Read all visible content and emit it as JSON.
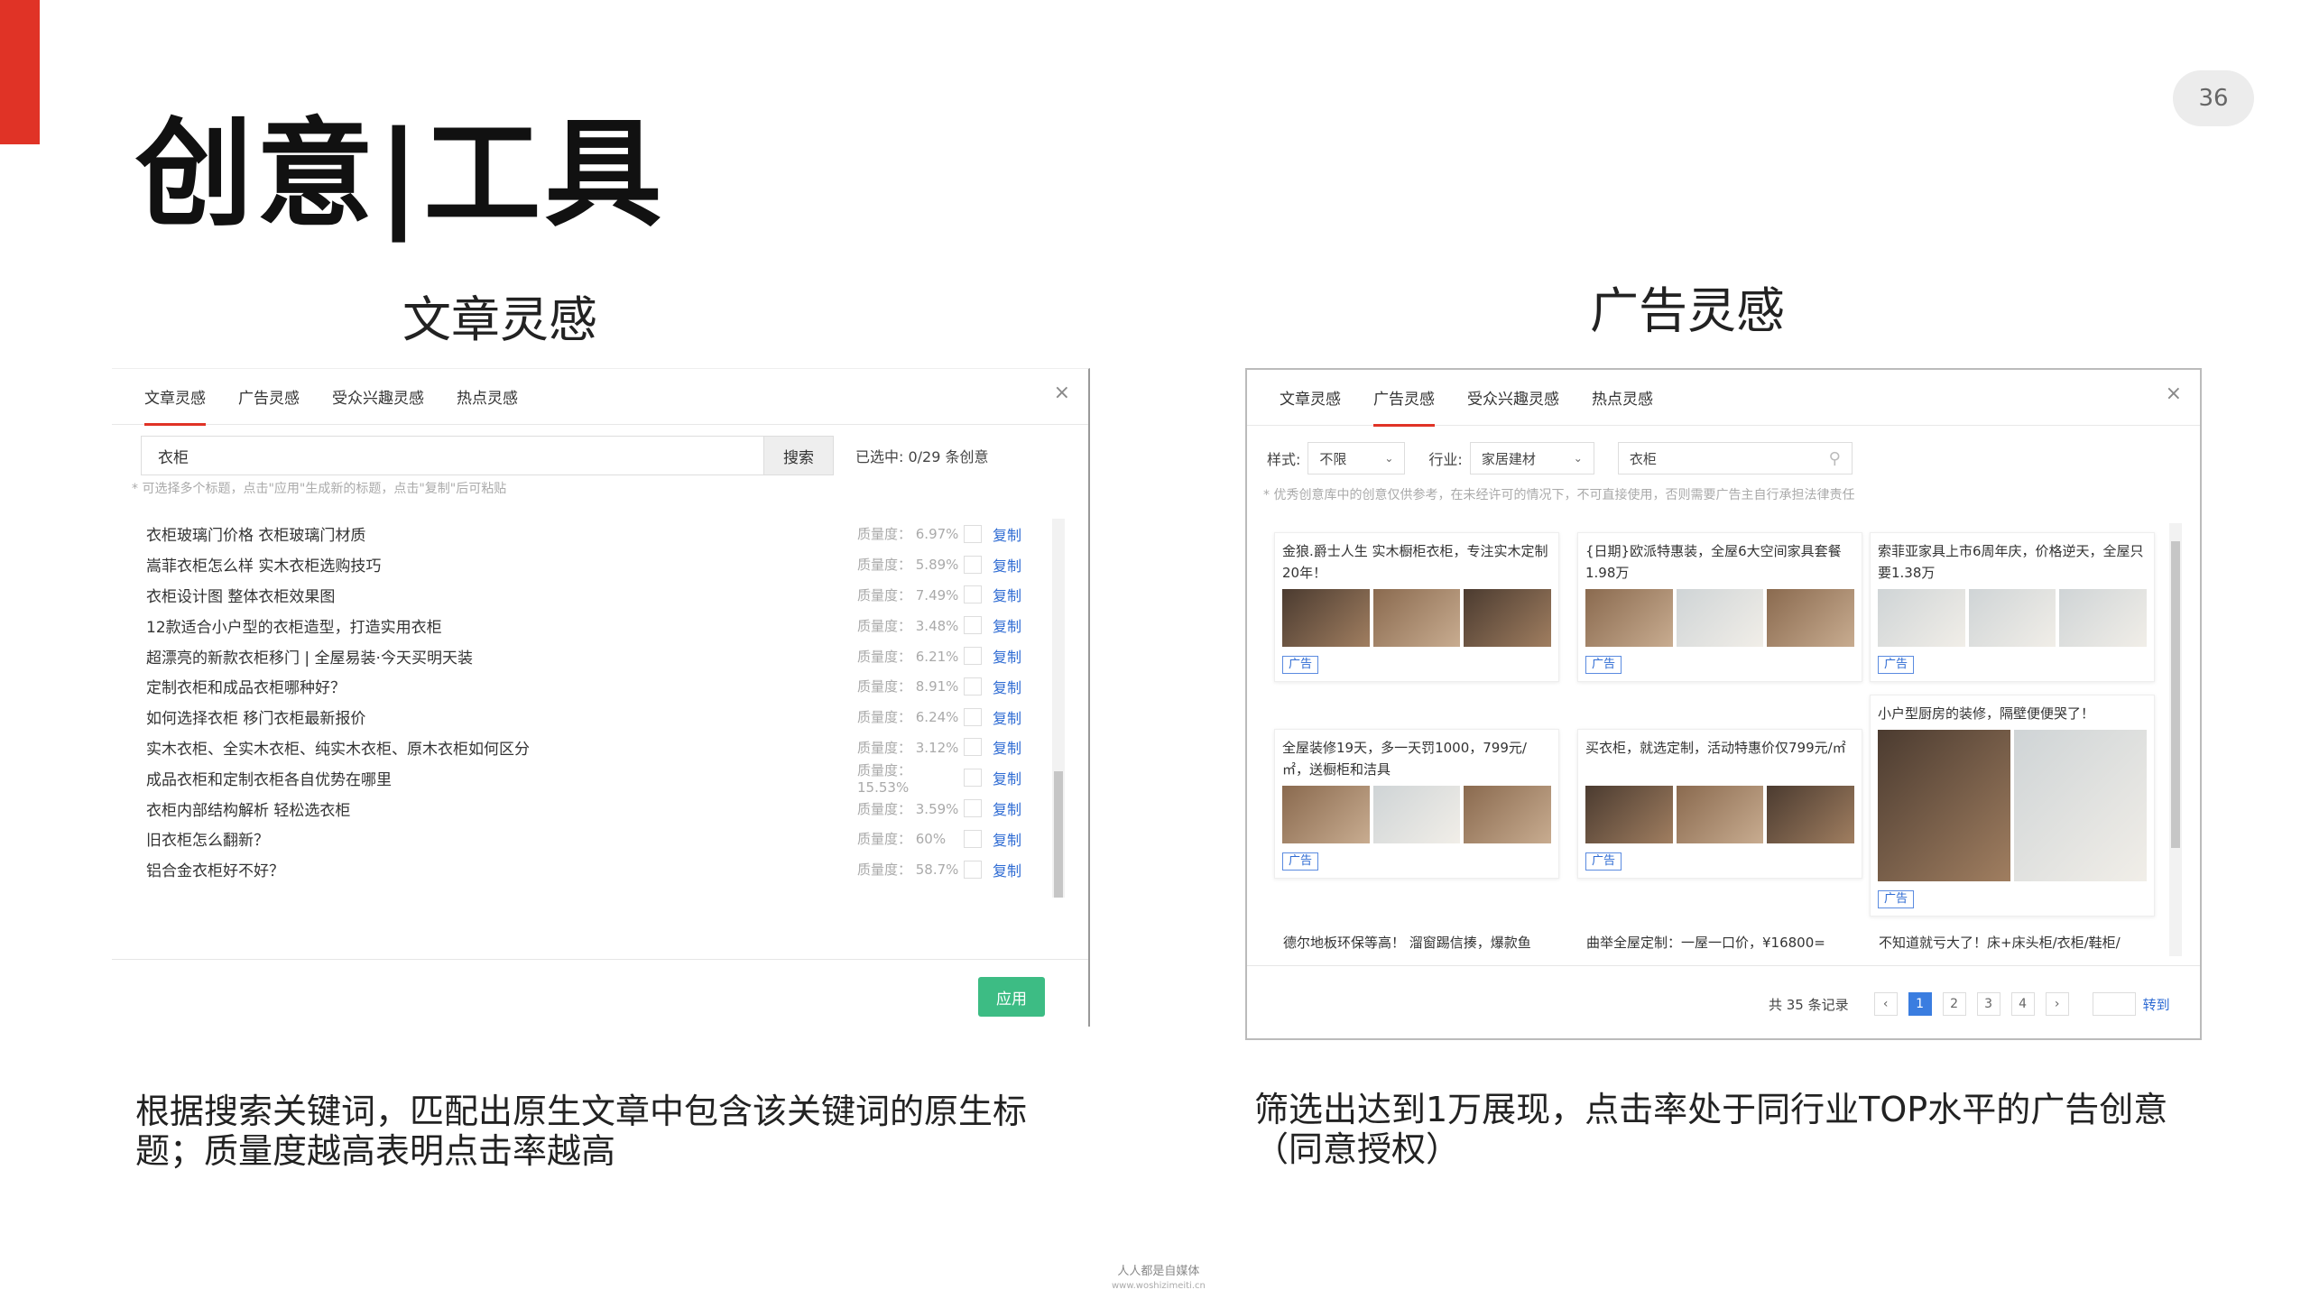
{
  "page": {
    "number": "36",
    "title": "创意|工具",
    "accent_color": "#e03326"
  },
  "left": {
    "section_title": "文章灵感",
    "tabs": [
      "文章灵感",
      "广告灵感",
      "受众兴趣灵感",
      "热点灵感"
    ],
    "close": "×",
    "search_value": "衣柜",
    "search_button": "搜索",
    "selected_count": "已选中: 0/29 条创意",
    "hint": "* 可选择多个标题，点击\"应用\"生成新的标题，点击\"复制\"后可粘贴",
    "rows": [
      {
        "title": "衣柜玻璃门价格 衣柜玻璃门材质",
        "quality": "质量度： 6.97%",
        "copy": "复制"
      },
      {
        "title": "嵩菲衣柜怎么样 实木衣柜选购技巧",
        "quality": "质量度： 5.89%",
        "copy": "复制"
      },
      {
        "title": "衣柜设计图 整体衣柜效果图",
        "quality": "质量度： 7.49%",
        "copy": "复制"
      },
      {
        "title": "12款适合小户型的衣柜造型，打造实用衣柜",
        "quality": "质量度： 3.48%",
        "copy": "复制"
      },
      {
        "title": "超漂亮的新款衣柜移门 | 全屋易装·今天买明天装",
        "quality": "质量度： 6.21%",
        "copy": "复制"
      },
      {
        "title": "定制衣柜和成品衣柜哪种好？",
        "quality": "质量度： 8.91%",
        "copy": "复制"
      },
      {
        "title": "如何选择衣柜 移门衣柜最新报价",
        "quality": "质量度： 6.24%",
        "copy": "复制"
      },
      {
        "title": "实木衣柜、全实木衣柜、纯实木衣柜、原木衣柜如何区分",
        "quality": "质量度： 3.12%",
        "copy": "复制"
      },
      {
        "title": "成品衣柜和定制衣柜各自优势在哪里",
        "quality": "质量度： 15.53%",
        "copy": "复制"
      },
      {
        "title": "衣柜内部结构解析 轻松选衣柜",
        "quality": "质量度： 3.59%",
        "copy": "复制"
      },
      {
        "title": "旧衣柜怎么翻新？",
        "quality": "质量度： 60%",
        "copy": "复制"
      },
      {
        "title": "铝合金衣柜好不好？",
        "quality": "质量度： 58.7%",
        "copy": "复制"
      }
    ],
    "apply_button": "应用",
    "scroll_position": 0.67,
    "description": "根据搜索关键词，匹配出原生文章中包含该关键词的原生标题；质量度越高表明点击率越高"
  },
  "right": {
    "section_title": "广告灵感",
    "tabs": [
      "文章灵感",
      "广告灵感",
      "受众兴趣灵感",
      "热点灵感"
    ],
    "close": "×",
    "filters": {
      "style_label": "样式:",
      "style_value": "不限",
      "industry_label": "行业:",
      "industry_value": "家居建材",
      "keyword_value": "衣柜"
    },
    "hint": "* 优秀创意库中的创意仅供参考，在未经许可的情况下，不可直接使用，否则需要广告主自行承担法律责任",
    "cards": [
      {
        "text": "金狼.爵士人生 实木橱柜衣柜，专注实木定制20年！",
        "ad": "广告"
      },
      {
        "text": "{日期}欧派特惠装，全屋6大空间家具套餐1.98万",
        "ad": "广告"
      },
      {
        "text": "索菲亚家具上市6周年庆，价格逆天，全屋只要1.38万",
        "ad": "广告"
      },
      {
        "text": "全屋装修19天，多一天罚1000，799元/㎡，送橱柜和洁具",
        "ad": "广告"
      },
      {
        "text": "买衣柜，就选定制，活动特惠价仅799元/㎡",
        "ad": "广告"
      },
      {
        "text": "小户型厨房的装修，隔壁便便哭了！",
        "ad": "广告"
      }
    ],
    "peek_rows": [
      "德尔地板环保等高！ 溜窗踢信揍，爆款鱼",
      "曲举全屋定制：一屋一口价，¥16800=",
      "不知道就亏大了！床+床头柜/衣柜/鞋柜/"
    ],
    "pager": {
      "total": "共 35 条记录",
      "prev": "‹",
      "pages": [
        "1",
        "2",
        "3",
        "4"
      ],
      "next": "›",
      "jump": "转到"
    },
    "description": "筛选出达到1万展现，点击率处于同行业TOP水平的广告创意（同意授权）"
  },
  "watermark": {
    "line1": "人人都是自媒体",
    "line2": "www.woshizimeiti.cn"
  }
}
